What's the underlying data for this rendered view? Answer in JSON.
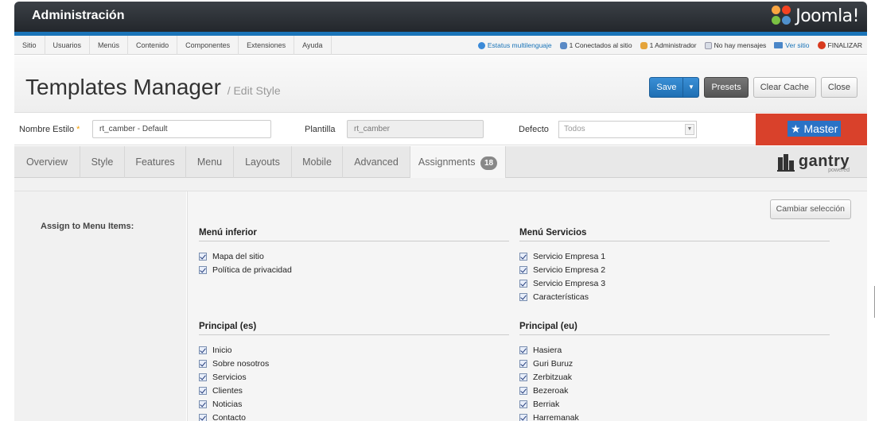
{
  "header": {
    "title": "Administración",
    "logo_text": "Joomla!"
  },
  "menubar": {
    "items": [
      "Sitio",
      "Usuarios",
      "Menús",
      "Contenido",
      "Componentes",
      "Extensiones",
      "Ayuda"
    ],
    "status": {
      "multilang": "Estatus multilenguaje",
      "connected": "1 Conectados al sitio",
      "admin": "1 Administrador",
      "messages": "No hay mensajes",
      "view_site": "Ver sitio",
      "logout": "FINALIZAR"
    }
  },
  "toolbar": {
    "title": "Templates Manager",
    "subtitle": "/ Edit Style",
    "save": "Save",
    "presets": "Presets",
    "clear_cache": "Clear Cache",
    "close": "Close"
  },
  "form": {
    "style_name_label": "Nombre Estilo",
    "required_mark": "*",
    "style_name_value": "rt_camber - Default",
    "template_label": "Plantilla",
    "template_value": "rt_camber",
    "default_label": "Defecto",
    "default_value": "Todos",
    "master": "★ Master"
  },
  "tabs": [
    {
      "label": "Overview"
    },
    {
      "label": "Style"
    },
    {
      "label": "Features"
    },
    {
      "label": "Menu"
    },
    {
      "label": "Layouts"
    },
    {
      "label": "Mobile"
    },
    {
      "label": "Advanced"
    },
    {
      "label": "Assignments",
      "badge": "18"
    }
  ],
  "gantry": {
    "word": "gantry",
    "sub": "powered"
  },
  "assignments": {
    "label": "Assign to Menu Items:",
    "change_button": "Cambiar selección",
    "groups": [
      {
        "title": "Menú inferior",
        "items": [
          "Mapa del sitio",
          "Política de privacidad"
        ]
      },
      {
        "title": "Menú Servicios",
        "items": [
          "Servicio Empresa 1",
          "Servicio Empresa 2",
          "Servicio Empresa 3",
          "Características"
        ]
      },
      {
        "title": "Principal (es)",
        "items": [
          "Inicio",
          "Sobre nosotros",
          "Servicios",
          "Clientes",
          "Noticias",
          "Contacto"
        ]
      },
      {
        "title": "Principal (eu)",
        "items": [
          "Hasiera",
          "Guri Buruz",
          "Zerbitzuak",
          "Bezeroak",
          "Berriak",
          "Harremanak"
        ]
      }
    ]
  }
}
